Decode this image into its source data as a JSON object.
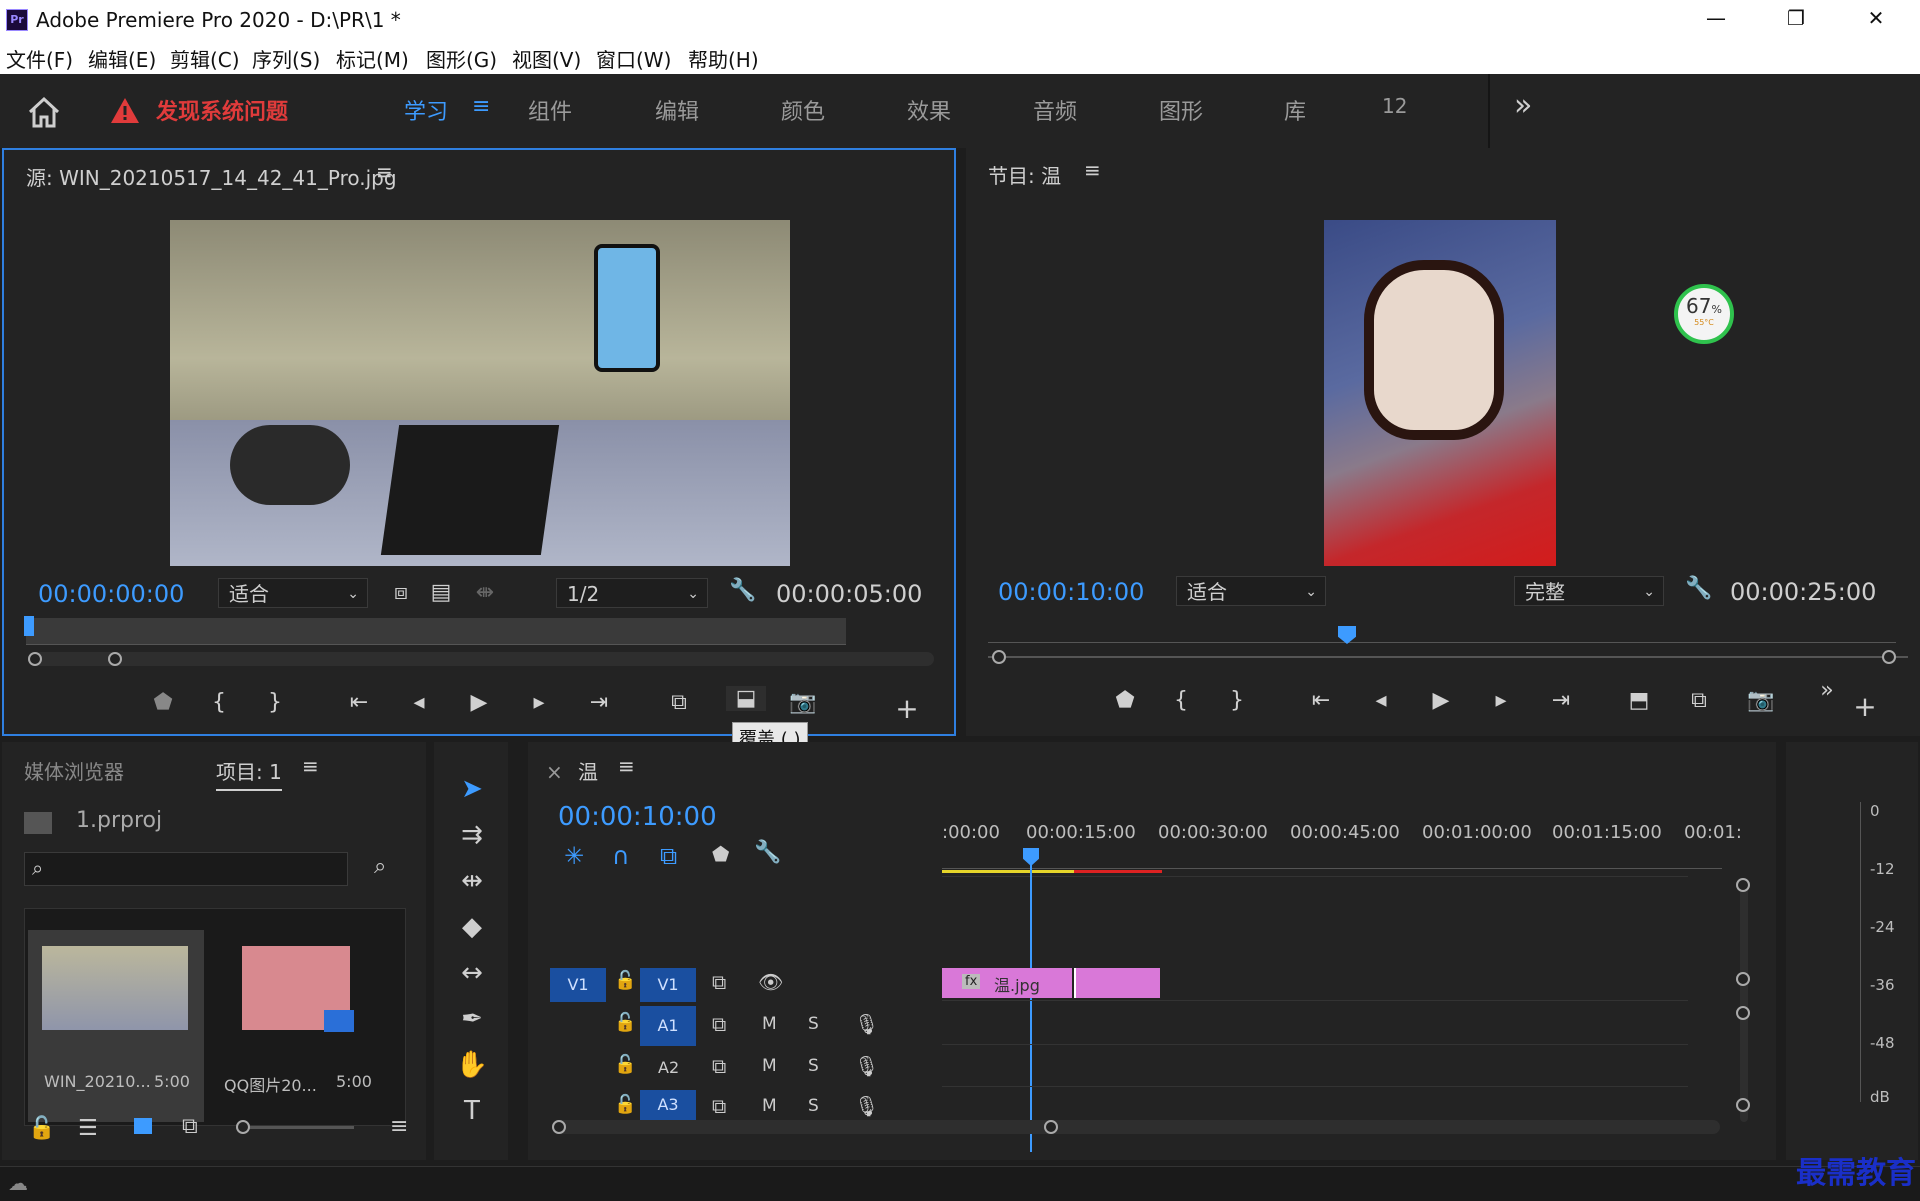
{
  "window": {
    "title": "Adobe Premiere Pro 2020 - D:\\PR\\1 *",
    "logo": "Pr",
    "minimize": "—",
    "maximize": "❐",
    "close": "✕"
  },
  "menu": [
    "文件(F)",
    "编辑(E)",
    "剪辑(C)",
    "序列(S)",
    "标记(M)",
    "图形(G)",
    "视图(V)",
    "窗口(W)",
    "帮助(H)"
  ],
  "workspaces": {
    "alert": "发现系统问题",
    "tabs": [
      "学习",
      "组件",
      "编辑",
      "颜色",
      "效果",
      "音频",
      "图形",
      "库",
      "12"
    ],
    "active": "学习",
    "more": "»"
  },
  "source_monitor": {
    "title": "源: WIN_20210517_14_42_41_Pro.jpg",
    "timecode": "00:00:00:00",
    "fit": "适合",
    "resolution": "1/2",
    "duration": "00:00:05:00",
    "tooltip": "覆盖 (.)"
  },
  "program_monitor": {
    "title": "节目: 温",
    "timecode": "00:00:10:00",
    "fit": "适合",
    "quality": "完整",
    "duration": "00:00:25:00",
    "cpu_widget": {
      "percent": "67",
      "unit": "%",
      "temp": "55°C"
    }
  },
  "project_panel": {
    "tab_media": "媒体浏览器",
    "tab_project": "项目: 1",
    "project_file": "1.prproj",
    "search_placeholder": "",
    "items": [
      {
        "name": "WIN_20210...",
        "duration": "5:00"
      },
      {
        "name": "QQ图片20...",
        "duration": "5:00"
      }
    ]
  },
  "timeline": {
    "close": "×",
    "sequence": "温",
    "timecode": "00:00:10:00",
    "ruler": [
      ":00:00",
      "00:00:15:00",
      "00:00:30:00",
      "00:00:45:00",
      "00:01:00:00",
      "00:01:15:00",
      "00:01:"
    ],
    "tracks": {
      "v1_src": "V1",
      "v1": "V1",
      "a1": "A1",
      "a2": "A2",
      "a3": "A3",
      "m": "M",
      "s": "S"
    },
    "clip": {
      "label": "温.jpg",
      "fx": "fx"
    }
  },
  "audio_meter": {
    "labels": [
      "0",
      "-12",
      "-24",
      "-36",
      "-48",
      "dB"
    ]
  },
  "watermark": "最需教育",
  "colors": {
    "accent": "#3d9bff",
    "alert": "#e03b3b",
    "clip": "#d978d8",
    "track_active": "#1a4fa0"
  }
}
